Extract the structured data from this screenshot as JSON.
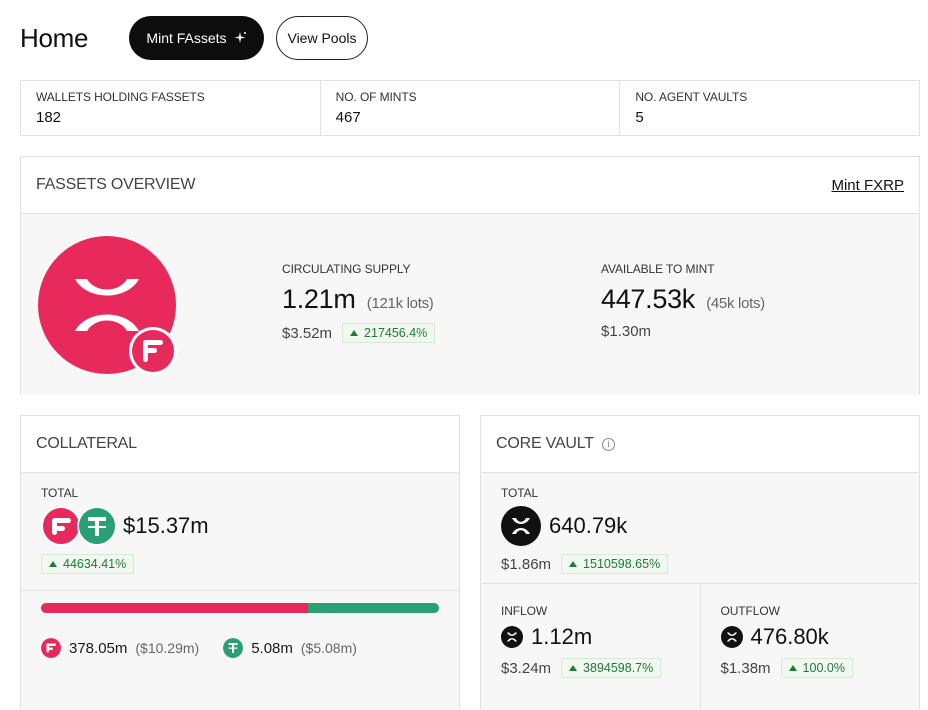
{
  "header": {
    "title": "Home",
    "mint_button": "Mint FAssets",
    "mint_button_icon": "sparkle-icon",
    "pools_button": "View Pools"
  },
  "stats": [
    {
      "label": "WALLETS HOLDING FASSETS",
      "value": "182"
    },
    {
      "label": "NO. OF MINTS",
      "value": "467"
    },
    {
      "label": "NO. AGENT VAULTS",
      "value": "5"
    }
  ],
  "overview": {
    "title": "FASSETS OVERVIEW",
    "link": "Mint FXRP",
    "supply": {
      "label": "CIRCULATING SUPPLY",
      "value": "1.21m",
      "lots": "(121k lots)",
      "usd": "$3.52m",
      "change": "217456.4%"
    },
    "available": {
      "label": "AVAILABLE TO MINT",
      "value": "447.53k",
      "lots": "(45k lots)",
      "usd": "$1.30m"
    }
  },
  "collateral": {
    "title": "COLLATERAL",
    "total_label": "TOTAL",
    "total_value": "$15.37m",
    "change": "44634.41%",
    "bar_fraction_flr": 0.67,
    "items": [
      {
        "value": "378.05m",
        "usd": "($10.29m)"
      },
      {
        "value": "5.08m",
        "usd": "($5.08m)"
      }
    ]
  },
  "core_vault": {
    "title": "CORE VAULT",
    "info_icon": "i",
    "total_label": "TOTAL",
    "total_value": "640.79k",
    "total_usd": "$1.86m",
    "total_change": "1510598.65%",
    "inflow": {
      "label": "INFLOW",
      "value": "1.12m",
      "usd": "$3.24m",
      "change": "3894598.7%"
    },
    "outflow": {
      "label": "OUTFLOW",
      "value": "476.80k",
      "usd": "$1.38m",
      "change": "100.0%"
    }
  },
  "colors": {
    "flare_pink": "#e8295c",
    "tether_green": "#2a9e74",
    "positive_green": "#1f7a3a"
  }
}
